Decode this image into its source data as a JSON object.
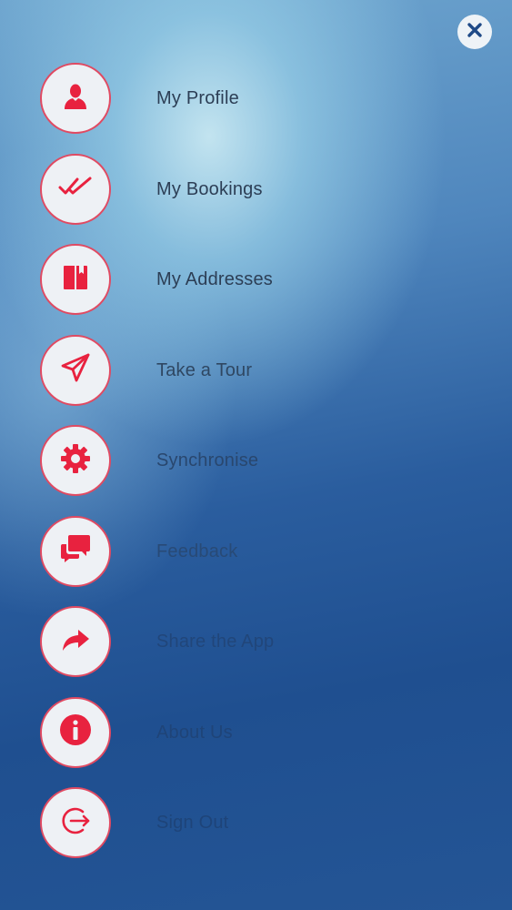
{
  "theme": {
    "accent": "#e8223f",
    "circle_border": "#e04a62",
    "circle_fill": "#eef1f5"
  },
  "close_button": {
    "icon": "close-icon"
  },
  "menu": {
    "items": [
      {
        "label": "My Profile",
        "icon": "user-icon",
        "color": "#2c3e55"
      },
      {
        "label": "My Bookings",
        "icon": "double-check-icon",
        "color": "#2c3e55"
      },
      {
        "label": "My Addresses",
        "icon": "book-icon",
        "color": "#2c3e55"
      },
      {
        "label": "Take a Tour",
        "icon": "paper-plane-icon",
        "color": "#2f4762"
      },
      {
        "label": "Synchronise",
        "icon": "gear-icon",
        "color": "#29476e"
      },
      {
        "label": "Feedback",
        "icon": "chat-icon",
        "color": "#284a76"
      },
      {
        "label": "Share the App",
        "icon": "share-icon",
        "color": "#21467a"
      },
      {
        "label": "About Us",
        "icon": "info-icon",
        "color": "#1f4478"
      },
      {
        "label": "Sign Out",
        "icon": "sign-out-icon",
        "color": "#1e4479"
      }
    ]
  }
}
